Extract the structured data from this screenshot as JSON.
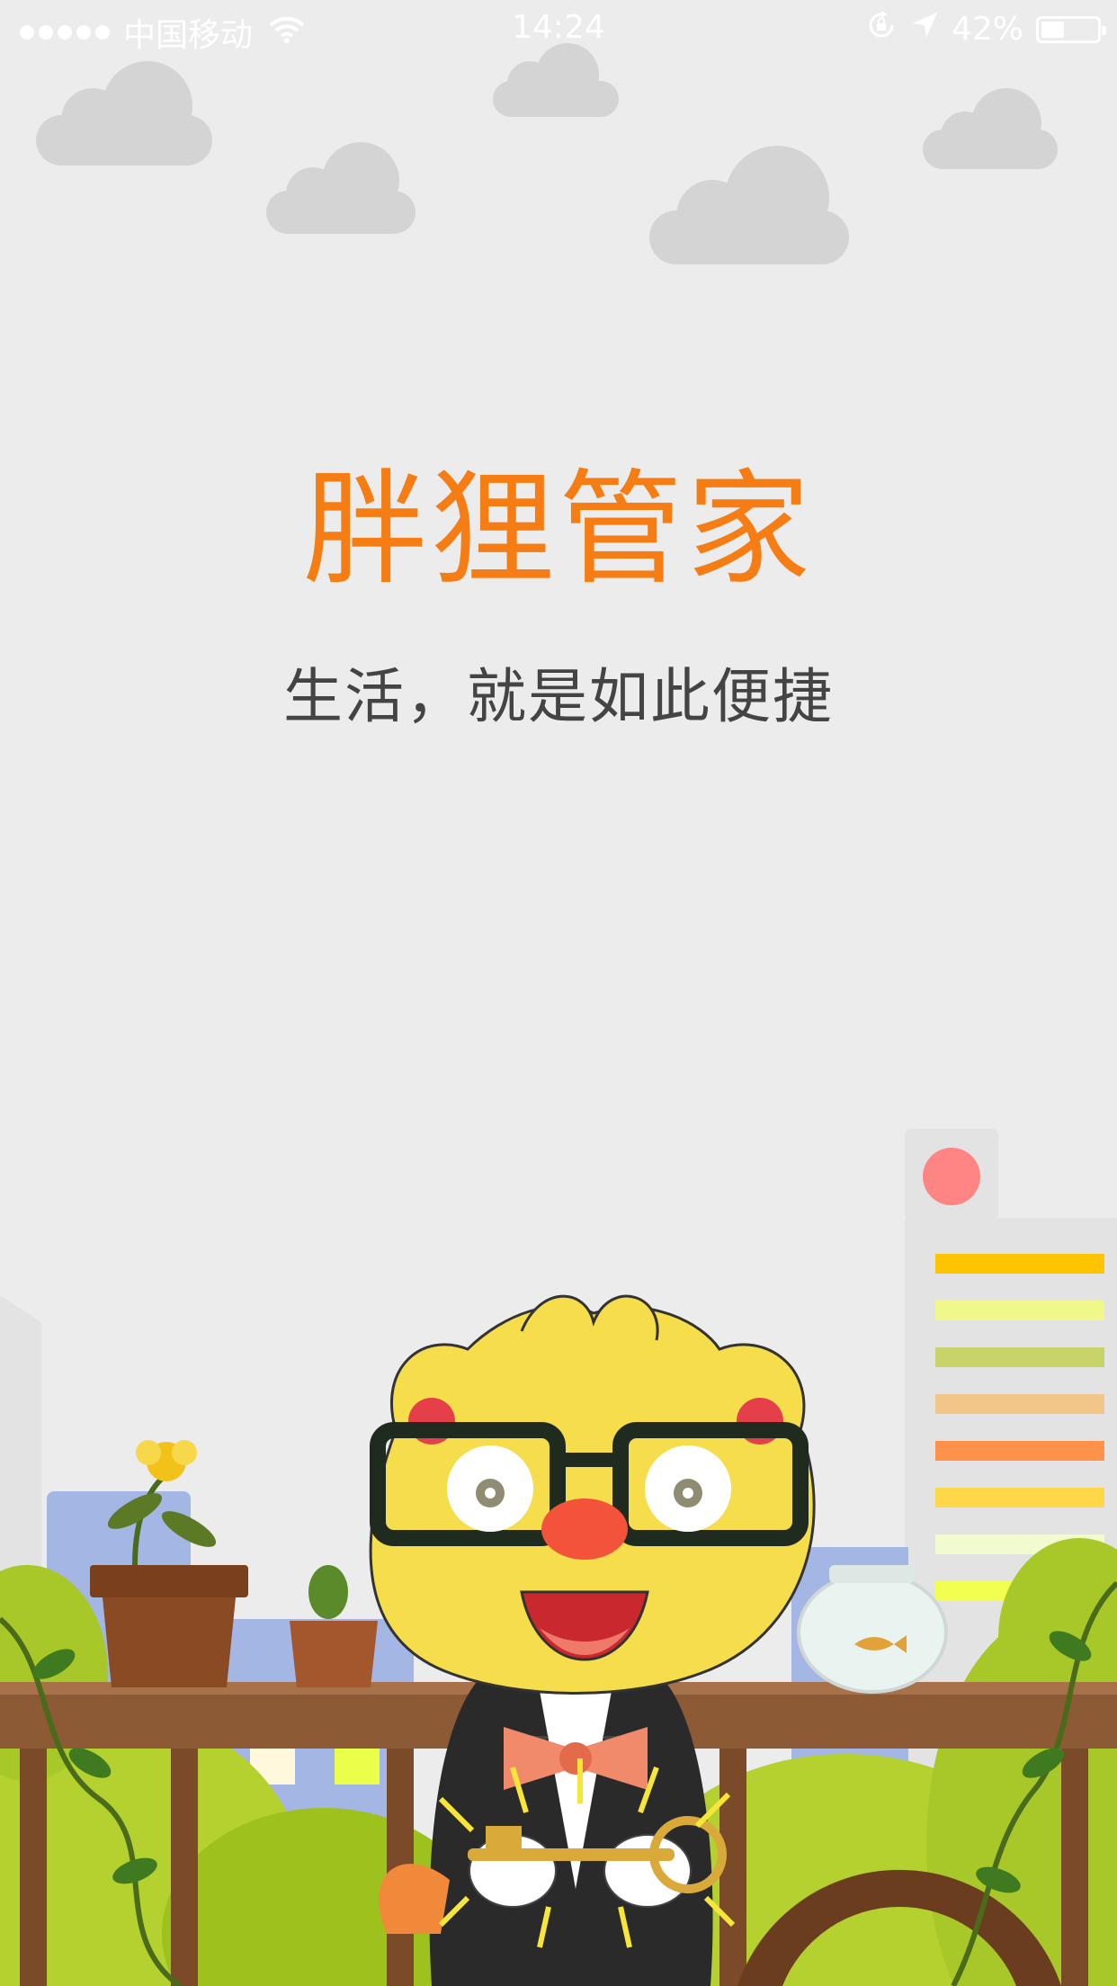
{
  "status_bar": {
    "carrier": "中国移动",
    "time": "14:24",
    "battery_percent_label": "42%",
    "battery_level": 0.42,
    "signal_bars": 5
  },
  "splash": {
    "app_name": "胖狸管家",
    "slogan": "生活，就是如此便捷"
  },
  "colors": {
    "background": "#ececec",
    "title": "#f57d14",
    "subtitle": "#444444",
    "cloud": "#d4d4d4"
  },
  "icons": {
    "wifi": "wifi-icon",
    "rotation_lock": "rotation-lock-icon",
    "location": "location-arrow-icon",
    "battery": "battery-icon"
  }
}
